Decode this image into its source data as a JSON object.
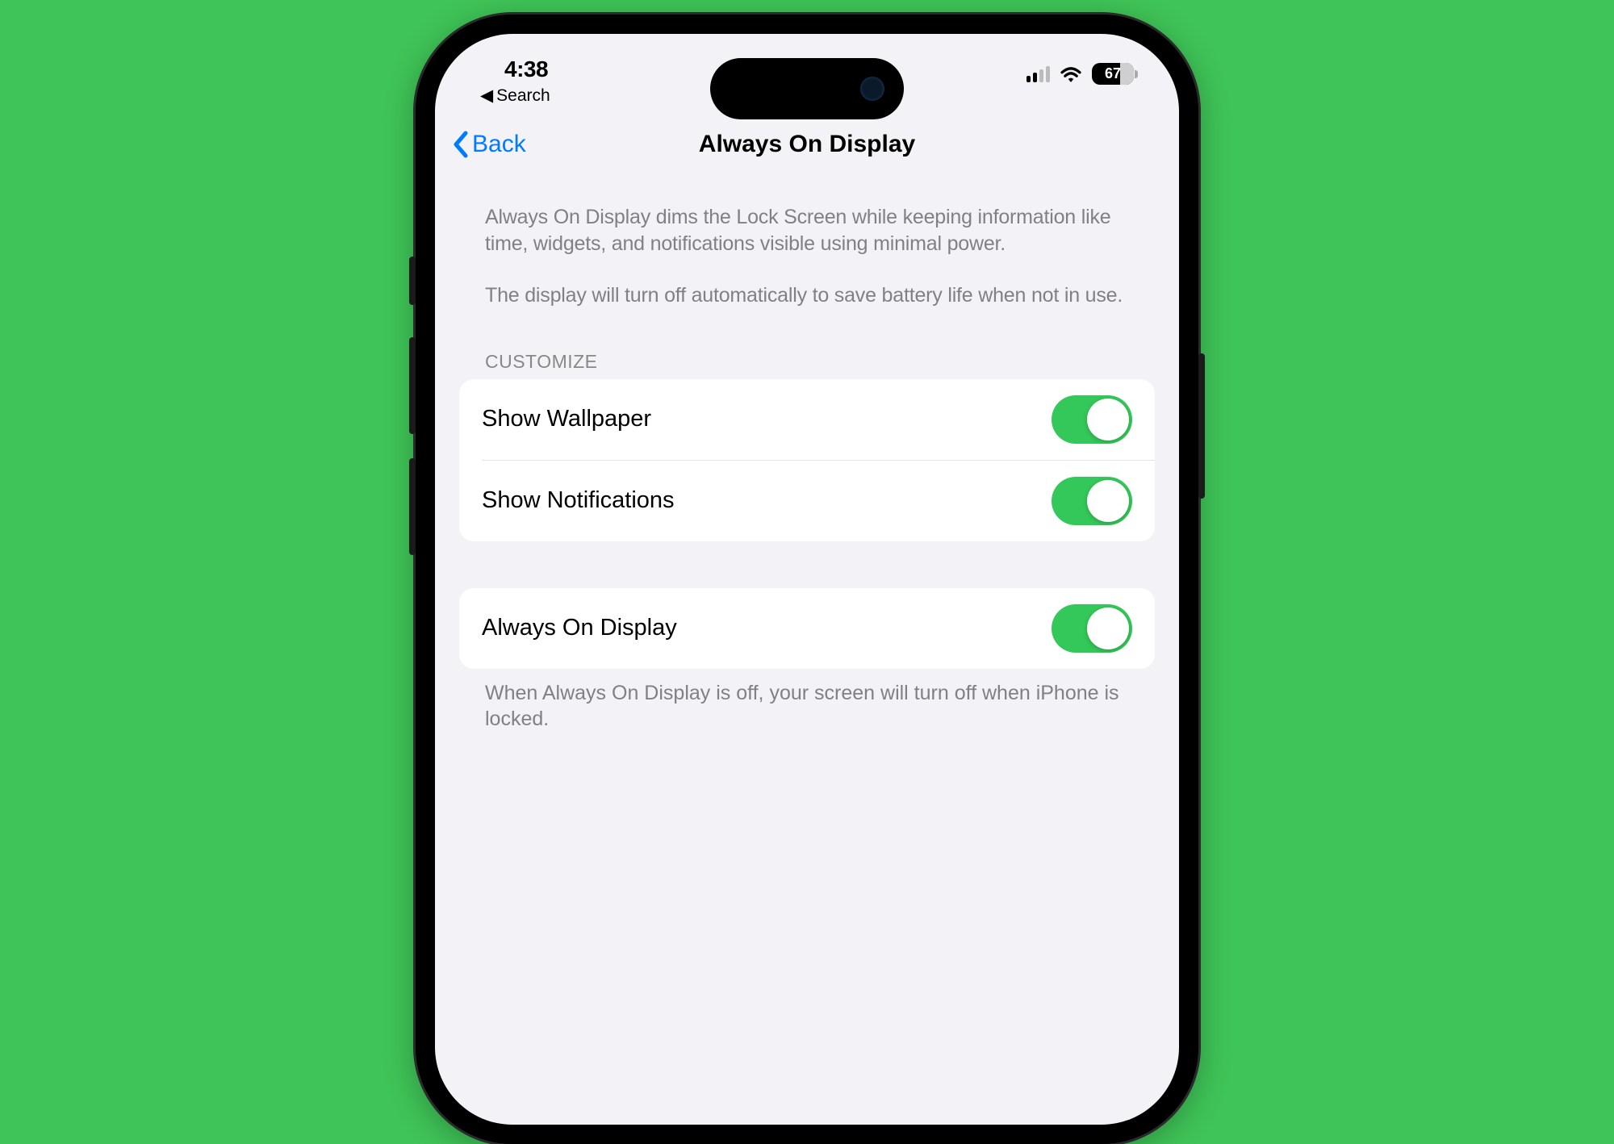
{
  "status": {
    "time": "4:38",
    "back_label": "Search",
    "battery": "67"
  },
  "nav": {
    "back": "Back",
    "title": "Always On Display"
  },
  "intro": {
    "p1": "Always On Display dims the Lock Screen while keeping information like time, widgets, and notifications visible using minimal power.",
    "p2": "The display will turn off automatically to save battery life when not in use."
  },
  "customize": {
    "header": "CUSTOMIZE",
    "rows": [
      {
        "label": "Show Wallpaper",
        "on": true
      },
      {
        "label": "Show Notifications",
        "on": true
      }
    ]
  },
  "main": {
    "rows": [
      {
        "label": "Always On Display",
        "on": true
      }
    ],
    "footer": "When Always On Display is off, your screen will turn off when iPhone is locked."
  }
}
